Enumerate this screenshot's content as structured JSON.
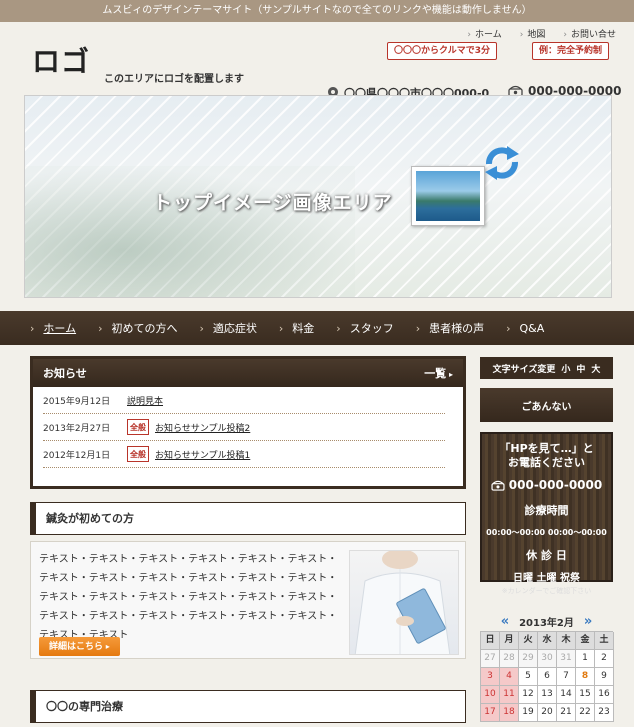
{
  "topbar": "ムスビィのデザインテーマサイト（サンプルサイトなので全てのリンクや機能は動作しません）",
  "header": {
    "logo": "ロゴ",
    "logo_caption": "このエリアにロゴを配置します",
    "links": [
      "ホーム",
      "地図",
      "お問い合せ"
    ],
    "badge1": "〇〇〇からクルマで3分",
    "badge2": "例：完全予約制",
    "address": "〇〇県〇〇〇市〇〇〇000-0",
    "phone": "000-000-0000"
  },
  "hero": {
    "text": "トップイメージ画像エリア"
  },
  "nav": [
    "ホーム",
    "初めての方へ",
    "適応症状",
    "料金",
    "スタッフ",
    "患者様の声",
    "Q&A"
  ],
  "news": {
    "title": "お知らせ",
    "more": "一覧",
    "items": [
      {
        "date": "2015年9月12日",
        "category": "",
        "title": "説明見本"
      },
      {
        "date": "2013年2月27日",
        "category": "全般",
        "title": "お知らせサンプル投稿2"
      },
      {
        "date": "2012年12月1日",
        "category": "全般",
        "title": "お知らせサンプル投稿1"
      }
    ]
  },
  "intro": {
    "heading": "鍼灸が初めての方",
    "text": "テキスト・テキスト・テキスト・テキスト・テキスト・テキスト・テキスト・テキスト・テキスト・テキスト・テキスト・テキスト・テキスト・テキスト・テキスト・テキスト・テキスト・テキスト・テキスト・テキスト・テキスト・テキスト・テキスト・テキスト・テキスト・テキスト",
    "button": "詳細はこちら"
  },
  "special": {
    "heading": "〇〇の専門治療"
  },
  "sidebar": {
    "fontsize_label": "文字サイズ変更",
    "fontsize_options": [
      "小",
      "中",
      "大"
    ],
    "guide": "ごあんない",
    "contact": {
      "line1": "「HPを見て…」と",
      "line2": "お電話ください",
      "tel": "000-000-0000",
      "hours_title": "診療時間",
      "hours": "00:00〜00:00 00:00〜00:00",
      "closed_title": "休 診 日",
      "closed": "日曜 土曜 祝祭",
      "note": "※カレンダーでご確認下さい"
    },
    "calendar": {
      "title": "2013年2月",
      "prev": "«",
      "next": "»",
      "weekdays": [
        "日",
        "月",
        "火",
        "水",
        "木",
        "金",
        "土"
      ],
      "cells": [
        "27",
        "28",
        "29",
        "30",
        "31",
        "1",
        "2",
        "3",
        "4",
        "5",
        "6",
        "7",
        "8",
        "9",
        "10",
        "11",
        "12",
        "13",
        "14",
        "15",
        "16",
        "17",
        "18",
        "19",
        "20",
        "21",
        "22",
        "23"
      ]
    }
  }
}
